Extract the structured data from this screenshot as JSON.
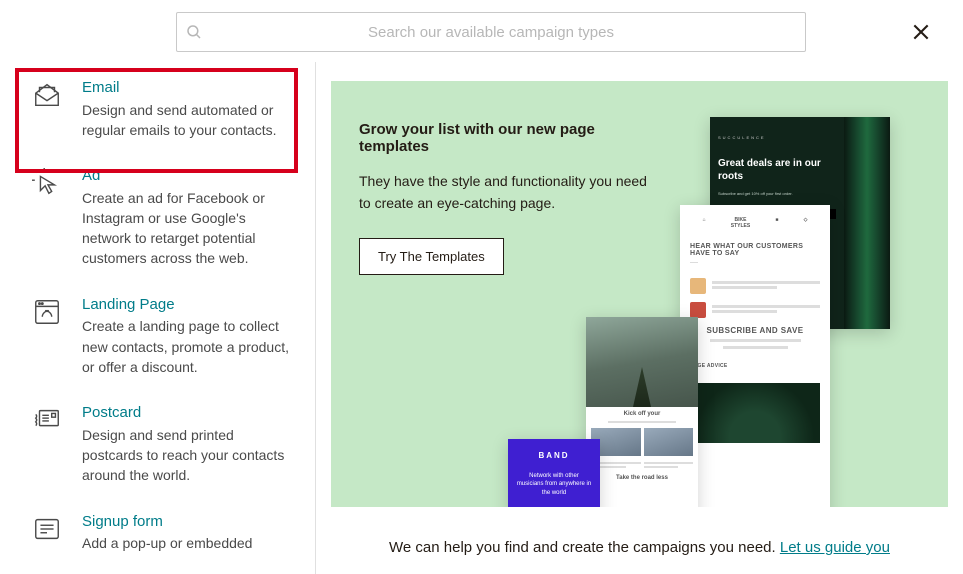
{
  "search": {
    "placeholder": "Search our available campaign types"
  },
  "sidebar": {
    "items": [
      {
        "title": "Email",
        "desc": "Design and send automated or regular emails to your contacts."
      },
      {
        "title": "Ad",
        "desc": "Create an ad for Facebook or Instagram or use Google's network to retarget potential customers across the web."
      },
      {
        "title": "Landing Page",
        "desc": "Create a landing page to collect new contacts, promote a product, or offer a discount."
      },
      {
        "title": "Postcard",
        "desc": "Design and send printed postcards to reach your contacts around the world."
      },
      {
        "title": "Signup form",
        "desc": "Add a pop-up or embedded"
      }
    ]
  },
  "hero": {
    "heading": "Grow your list with our new page templates",
    "body": "They have the style and functionality you need to create an eye-catching page.",
    "button": "Try The Templates"
  },
  "templates": {
    "purple": {
      "brand": "BAND",
      "text": "Network with other musicians from anywhere in the world"
    },
    "mid": {
      "h1": "Kick off your",
      "h2": "Take the road less"
    },
    "tall": {
      "logos": [
        "⌂",
        "BIKE\nSTYLES",
        "■",
        "◇"
      ],
      "hear": "HEAR WHAT OUR CUSTOMERS HAVE TO SAY",
      "sub_heading": "SUBSCRIBE AND SAVE",
      "sage": "SAGE ADVICE"
    },
    "dark": {
      "brand": "SUCCULENCE",
      "heading": "Great deals are in our roots",
      "sub": "Subscribe and get 10% off your first order."
    }
  },
  "footer": {
    "text": "We can help you find and create the campaigns you need. ",
    "link": "Let us guide you"
  }
}
